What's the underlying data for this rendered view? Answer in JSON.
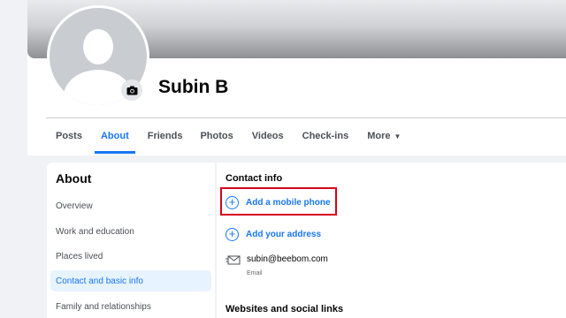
{
  "profile": {
    "name": "Subin B"
  },
  "tabs": [
    {
      "label": "Posts"
    },
    {
      "label": "About"
    },
    {
      "label": "Friends"
    },
    {
      "label": "Photos"
    },
    {
      "label": "Videos"
    },
    {
      "label": "Check-ins"
    },
    {
      "label": "More"
    }
  ],
  "sidebar": {
    "title": "About",
    "items": [
      {
        "label": "Overview"
      },
      {
        "label": "Work and education"
      },
      {
        "label": "Places lived"
      },
      {
        "label": "Contact and basic info"
      },
      {
        "label": "Family and relationships"
      }
    ],
    "active_item": "Contact and basic info"
  },
  "contact_info": {
    "title": "Contact info",
    "add_mobile_label": "Add a mobile phone",
    "add_address_label": "Add your address",
    "email_value": "subin@beebom.com",
    "email_label": "Email"
  },
  "websites": {
    "title": "Websites and social links"
  },
  "colors": {
    "accent": "#1877f2",
    "highlight_border": "#d6001c",
    "background": "#f0f2f5",
    "active_bg": "#e7f3ff"
  },
  "icons": {
    "camera": "camera-icon",
    "plus": "plus-circle-icon",
    "email": "envelope-icon",
    "more_caret": "caret-down-icon"
  }
}
